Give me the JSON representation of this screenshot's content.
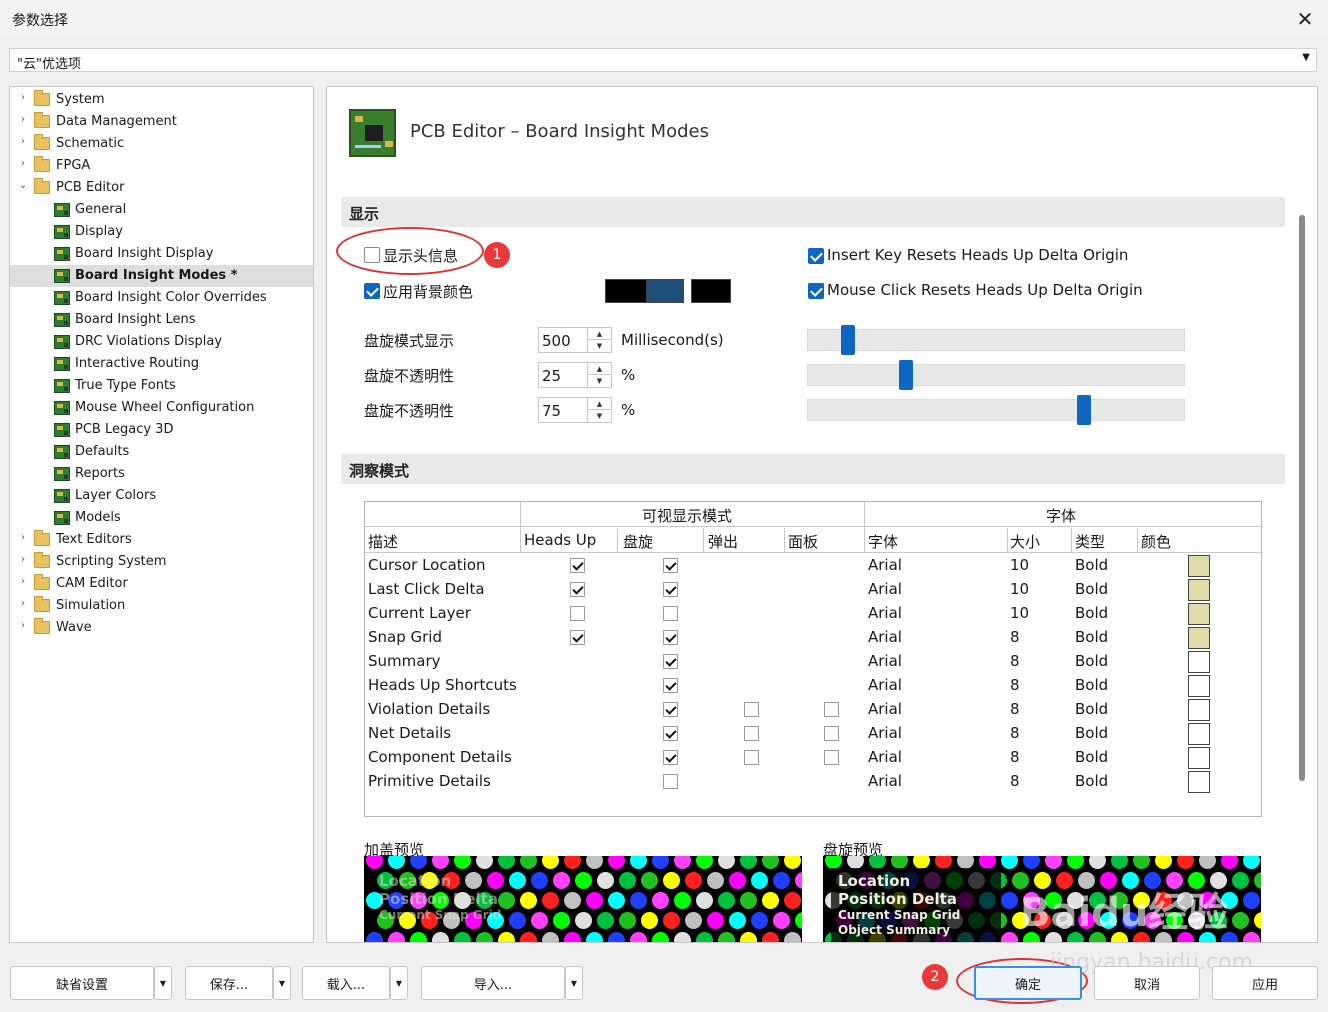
{
  "window": {
    "title": "参数选择",
    "close_icon": "close-icon"
  },
  "profile_select": {
    "value": "\"云\"优选项"
  },
  "tree": {
    "items": [
      {
        "label": "System",
        "level": 0,
        "expanded": false
      },
      {
        "label": "Data Management",
        "level": 0,
        "expanded": false
      },
      {
        "label": "Schematic",
        "level": 0,
        "expanded": false
      },
      {
        "label": "FPGA",
        "level": 0,
        "expanded": false
      },
      {
        "label": "PCB Editor",
        "level": 0,
        "expanded": true
      },
      {
        "label": "General",
        "level": 1
      },
      {
        "label": "Display",
        "level": 1
      },
      {
        "label": "Board Insight Display",
        "level": 1
      },
      {
        "label": "Board Insight Modes *",
        "level": 1,
        "selected": true
      },
      {
        "label": "Board Insight Color Overrides",
        "level": 1
      },
      {
        "label": "Board Insight Lens",
        "level": 1
      },
      {
        "label": "DRC Violations Display",
        "level": 1
      },
      {
        "label": "Interactive Routing",
        "level": 1
      },
      {
        "label": "True Type Fonts",
        "level": 1
      },
      {
        "label": "Mouse Wheel Configuration",
        "level": 1
      },
      {
        "label": "PCB Legacy 3D",
        "level": 1
      },
      {
        "label": "Defaults",
        "level": 1
      },
      {
        "label": "Reports",
        "level": 1
      },
      {
        "label": "Layer Colors",
        "level": 1
      },
      {
        "label": "Models",
        "level": 1
      },
      {
        "label": "Text Editors",
        "level": 0,
        "expanded": false
      },
      {
        "label": "Scripting System",
        "level": 0,
        "expanded": false
      },
      {
        "label": "CAM Editor",
        "level": 0,
        "expanded": false
      },
      {
        "label": "Simulation",
        "level": 0,
        "expanded": false
      },
      {
        "label": "Wave",
        "level": 0,
        "expanded": false
      }
    ]
  },
  "header": {
    "title": "PCB Editor – Board Insight Modes"
  },
  "display": {
    "section_title": "显示",
    "show_heads_up": {
      "label": "显示头信息",
      "checked": false
    },
    "use_bg_color": {
      "label": "应用背景颜色",
      "checked": true
    },
    "swatch_colors": [
      "#000000",
      "#1f4e79",
      "#000000"
    ],
    "insert_key_reset": {
      "label": "Insert Key Resets Heads Up Delta Origin",
      "checked": true
    },
    "mouse_click_reset": {
      "label": "Mouse Click Resets Heads Up Delta Origin",
      "checked": true
    },
    "rows": [
      {
        "label": "盘旋模式显示",
        "value": "500",
        "unit": "Millisecond(s)",
        "slider_level": 0.09
      },
      {
        "label": "盘旋不透明性",
        "value": "25",
        "unit": "%",
        "slider_level": 0.25
      },
      {
        "label": "盘旋不透明性",
        "value": "75",
        "unit": "%",
        "slider_level": 0.74
      }
    ]
  },
  "insight": {
    "section_title": "洞察模式",
    "group_visible": "可视显示模式",
    "group_font": "字体",
    "columns": {
      "desc": "描述",
      "headsup": "Heads Up",
      "hover": "盘旋",
      "popup": "弹出",
      "panel": "面板",
      "font": "字体",
      "size": "大小",
      "type": "类型",
      "color": "颜色"
    },
    "rows": [
      {
        "desc": "Cursor Location",
        "headsup": true,
        "hover": true,
        "popup": null,
        "panel": null,
        "font": "Arial",
        "size": "10",
        "type": "Bold",
        "color": "#e0dcaa"
      },
      {
        "desc": "Last Click Delta",
        "headsup": true,
        "hover": true,
        "popup": null,
        "panel": null,
        "font": "Arial",
        "size": "10",
        "type": "Bold",
        "color": "#e0dcaa"
      },
      {
        "desc": "Current Layer",
        "headsup": false,
        "hover": false,
        "popup": null,
        "panel": null,
        "font": "Arial",
        "size": "10",
        "type": "Bold",
        "color": "#e0dcaa"
      },
      {
        "desc": "Snap Grid",
        "headsup": true,
        "hover": true,
        "popup": null,
        "panel": null,
        "font": "Arial",
        "size": "8",
        "type": "Bold",
        "color": "#e0dcaa"
      },
      {
        "desc": "Summary",
        "headsup": null,
        "hover": true,
        "popup": null,
        "panel": null,
        "font": "Arial",
        "size": "8",
        "type": "Bold",
        "color": "#ffffff"
      },
      {
        "desc": "Heads Up Shortcuts",
        "headsup": null,
        "hover": true,
        "popup": null,
        "panel": null,
        "font": "Arial",
        "size": "8",
        "type": "Bold",
        "color": "#ffffff"
      },
      {
        "desc": "Violation Details",
        "headsup": null,
        "hover": true,
        "popup": false,
        "panel": false,
        "font": "Arial",
        "size": "8",
        "type": "Bold",
        "color": "#ffffff"
      },
      {
        "desc": "Net Details",
        "headsup": null,
        "hover": true,
        "popup": false,
        "panel": false,
        "font": "Arial",
        "size": "8",
        "type": "Bold",
        "color": "#ffffff"
      },
      {
        "desc": "Component Details",
        "headsup": null,
        "hover": true,
        "popup": false,
        "panel": false,
        "font": "Arial",
        "size": "8",
        "type": "Bold",
        "color": "#ffffff"
      },
      {
        "desc": "Primitive Details",
        "headsup": null,
        "hover": false,
        "popup": null,
        "panel": null,
        "font": "Arial",
        "size": "8",
        "type": "Bold",
        "color": "#ffffff"
      }
    ]
  },
  "previews": {
    "overlay": {
      "label": "加盖预览",
      "lines": [
        "Location",
        "Position Delta",
        "Current Snap Grid"
      ]
    },
    "hover": {
      "label": "盘旋预览",
      "lines": [
        "Location",
        "Position Delta",
        "Current Snap Grid",
        "Object Summary"
      ]
    }
  },
  "buttons": {
    "defaults": "缺省设置",
    "save": "保存...",
    "load": "载入...",
    "import": "导入...",
    "ok": "确定",
    "cancel": "取消",
    "apply": "应用"
  },
  "annotations": {
    "badge1": "1",
    "badge2": "2"
  },
  "watermark": {
    "logo": "Baidu经验",
    "url": "jingyan.baidu.com"
  }
}
